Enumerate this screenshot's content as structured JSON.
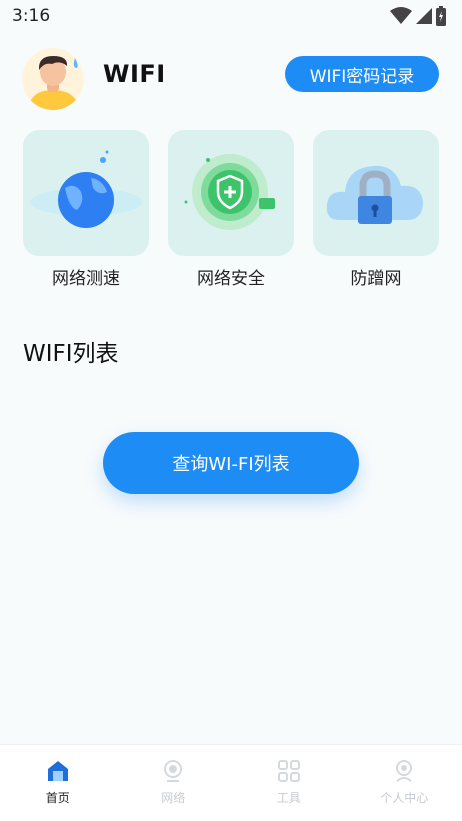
{
  "status_bar": {
    "time": "3:16",
    "icons": [
      "wifi-icon",
      "cell-signal-icon",
      "battery-icon"
    ]
  },
  "header": {
    "title": "WIFI",
    "password_record_label": "WIFI密码记录",
    "avatar_icon": "avatar-icon"
  },
  "tools": [
    {
      "label": "网络测速",
      "icon": "globe-speed-icon"
    },
    {
      "label": "网络安全",
      "icon": "shield-icon"
    },
    {
      "label": "防蹭网",
      "icon": "cloud-lock-icon"
    }
  ],
  "wifi_list": {
    "title": "WIFI列表",
    "query_label": "查询WI-FI列表"
  },
  "bottom_nav": {
    "items": [
      {
        "label": "首页",
        "icon": "home-icon",
        "active": true
      },
      {
        "label": "网络",
        "icon": "network-icon",
        "active": false
      },
      {
        "label": "工具",
        "icon": "tools-icon",
        "active": false
      },
      {
        "label": "个人中心",
        "icon": "user-center-icon",
        "active": false
      }
    ]
  },
  "colors": {
    "accent": "#1e8cf5",
    "card_bg": "#dbf1f0",
    "page_bg": "#f8fbfc",
    "nav_inactive": "#c7cbd0"
  }
}
